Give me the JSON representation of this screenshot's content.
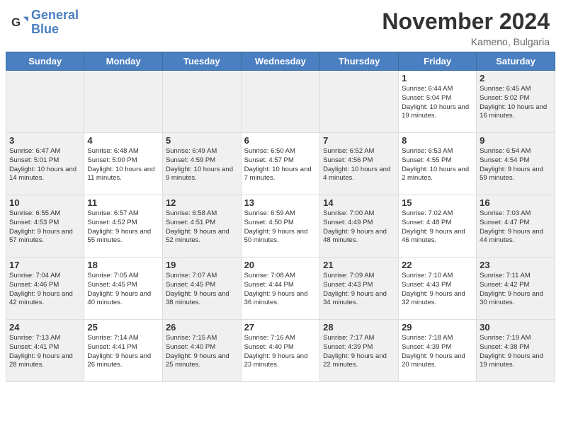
{
  "header": {
    "logo_line1": "General",
    "logo_line2": "Blue",
    "month_title": "November 2024",
    "location": "Kameno, Bulgaria"
  },
  "weekdays": [
    "Sunday",
    "Monday",
    "Tuesday",
    "Wednesday",
    "Thursday",
    "Friday",
    "Saturday"
  ],
  "weeks": [
    [
      {
        "day": "",
        "info": "",
        "shaded": true
      },
      {
        "day": "",
        "info": "",
        "shaded": true
      },
      {
        "day": "",
        "info": "",
        "shaded": true
      },
      {
        "day": "",
        "info": "",
        "shaded": true
      },
      {
        "day": "",
        "info": "",
        "shaded": true
      },
      {
        "day": "1",
        "info": "Sunrise: 6:44 AM\nSunset: 5:04 PM\nDaylight: 10 hours and 19 minutes."
      },
      {
        "day": "2",
        "info": "Sunrise: 6:45 AM\nSunset: 5:02 PM\nDaylight: 10 hours and 16 minutes.",
        "shaded": true
      }
    ],
    [
      {
        "day": "3",
        "info": "Sunrise: 6:47 AM\nSunset: 5:01 PM\nDaylight: 10 hours and 14 minutes.",
        "shaded": true
      },
      {
        "day": "4",
        "info": "Sunrise: 6:48 AM\nSunset: 5:00 PM\nDaylight: 10 hours and 11 minutes."
      },
      {
        "day": "5",
        "info": "Sunrise: 6:49 AM\nSunset: 4:59 PM\nDaylight: 10 hours and 9 minutes.",
        "shaded": true
      },
      {
        "day": "6",
        "info": "Sunrise: 6:50 AM\nSunset: 4:57 PM\nDaylight: 10 hours and 7 minutes."
      },
      {
        "day": "7",
        "info": "Sunrise: 6:52 AM\nSunset: 4:56 PM\nDaylight: 10 hours and 4 minutes.",
        "shaded": true
      },
      {
        "day": "8",
        "info": "Sunrise: 6:53 AM\nSunset: 4:55 PM\nDaylight: 10 hours and 2 minutes."
      },
      {
        "day": "9",
        "info": "Sunrise: 6:54 AM\nSunset: 4:54 PM\nDaylight: 9 hours and 59 minutes.",
        "shaded": true
      }
    ],
    [
      {
        "day": "10",
        "info": "Sunrise: 6:55 AM\nSunset: 4:53 PM\nDaylight: 9 hours and 57 minutes.",
        "shaded": true
      },
      {
        "day": "11",
        "info": "Sunrise: 6:57 AM\nSunset: 4:52 PM\nDaylight: 9 hours and 55 minutes."
      },
      {
        "day": "12",
        "info": "Sunrise: 6:58 AM\nSunset: 4:51 PM\nDaylight: 9 hours and 52 minutes.",
        "shaded": true
      },
      {
        "day": "13",
        "info": "Sunrise: 6:59 AM\nSunset: 4:50 PM\nDaylight: 9 hours and 50 minutes."
      },
      {
        "day": "14",
        "info": "Sunrise: 7:00 AM\nSunset: 4:49 PM\nDaylight: 9 hours and 48 minutes.",
        "shaded": true
      },
      {
        "day": "15",
        "info": "Sunrise: 7:02 AM\nSunset: 4:48 PM\nDaylight: 9 hours and 46 minutes."
      },
      {
        "day": "16",
        "info": "Sunrise: 7:03 AM\nSunset: 4:47 PM\nDaylight: 9 hours and 44 minutes.",
        "shaded": true
      }
    ],
    [
      {
        "day": "17",
        "info": "Sunrise: 7:04 AM\nSunset: 4:46 PM\nDaylight: 9 hours and 42 minutes.",
        "shaded": true
      },
      {
        "day": "18",
        "info": "Sunrise: 7:05 AM\nSunset: 4:45 PM\nDaylight: 9 hours and 40 minutes."
      },
      {
        "day": "19",
        "info": "Sunrise: 7:07 AM\nSunset: 4:45 PM\nDaylight: 9 hours and 38 minutes.",
        "shaded": true
      },
      {
        "day": "20",
        "info": "Sunrise: 7:08 AM\nSunset: 4:44 PM\nDaylight: 9 hours and 36 minutes."
      },
      {
        "day": "21",
        "info": "Sunrise: 7:09 AM\nSunset: 4:43 PM\nDaylight: 9 hours and 34 minutes.",
        "shaded": true
      },
      {
        "day": "22",
        "info": "Sunrise: 7:10 AM\nSunset: 4:43 PM\nDaylight: 9 hours and 32 minutes."
      },
      {
        "day": "23",
        "info": "Sunrise: 7:11 AM\nSunset: 4:42 PM\nDaylight: 9 hours and 30 minutes.",
        "shaded": true
      }
    ],
    [
      {
        "day": "24",
        "info": "Sunrise: 7:13 AM\nSunset: 4:41 PM\nDaylight: 9 hours and 28 minutes.",
        "shaded": true
      },
      {
        "day": "25",
        "info": "Sunrise: 7:14 AM\nSunset: 4:41 PM\nDaylight: 9 hours and 26 minutes."
      },
      {
        "day": "26",
        "info": "Sunrise: 7:15 AM\nSunset: 4:40 PM\nDaylight: 9 hours and 25 minutes.",
        "shaded": true
      },
      {
        "day": "27",
        "info": "Sunrise: 7:16 AM\nSunset: 4:40 PM\nDaylight: 9 hours and 23 minutes."
      },
      {
        "day": "28",
        "info": "Sunrise: 7:17 AM\nSunset: 4:39 PM\nDaylight: 9 hours and 22 minutes.",
        "shaded": true
      },
      {
        "day": "29",
        "info": "Sunrise: 7:18 AM\nSunset: 4:39 PM\nDaylight: 9 hours and 20 minutes."
      },
      {
        "day": "30",
        "info": "Sunrise: 7:19 AM\nSunset: 4:38 PM\nDaylight: 9 hours and 19 minutes.",
        "shaded": true
      }
    ]
  ]
}
